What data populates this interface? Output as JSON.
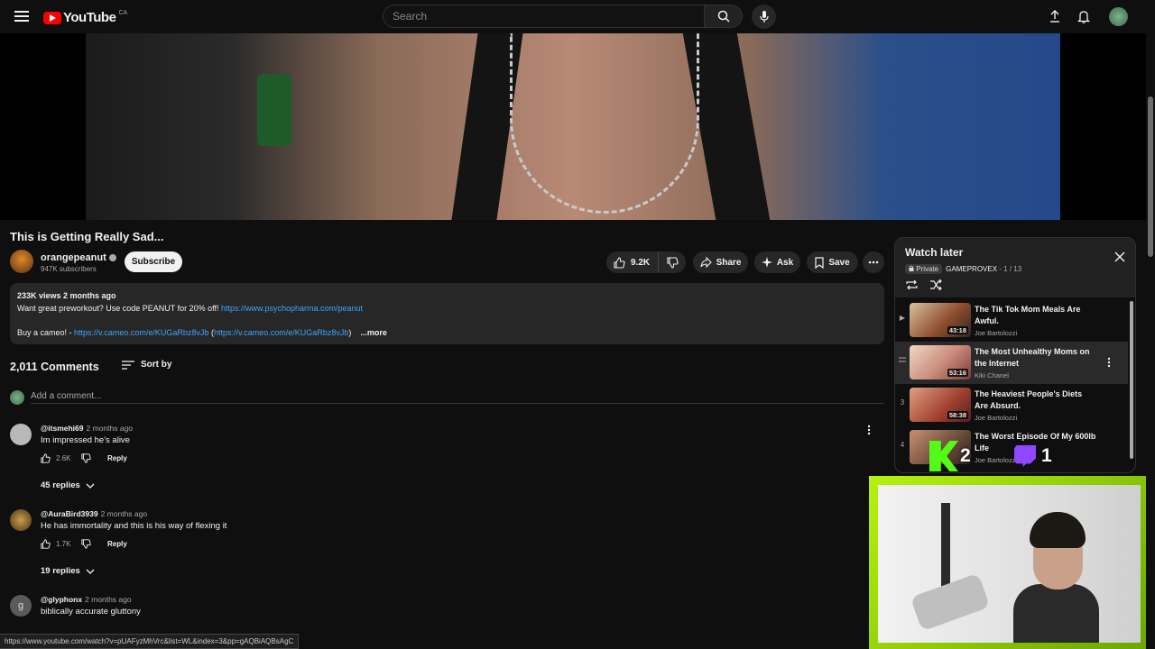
{
  "header": {
    "logo_text": "YouTube",
    "region": "CA",
    "search_placeholder": "Search"
  },
  "video": {
    "title": "This is Getting Really Sad...",
    "channel": "orangepeanut",
    "subscribers": "947K subscribers",
    "subscribe_label": "Subscribe",
    "likes": "9.2K",
    "share_label": "Share",
    "ask_label": "Ask",
    "save_label": "Save"
  },
  "description": {
    "stats": "233K views  2 months ago",
    "line1_text": "Want great preworkout? Use code PEANUT for 20% off! ",
    "line1_link": "https://www.psychopharma.com/peanut",
    "line2_text": "Buy a cameo! - ",
    "line2_link": "https://v.cameo.com/e/KUGaRbz8vJb",
    "line2_paren_open": " (",
    "line2_link2": "https://v.cameo.com/e/KUGaRbz8vJb",
    "line2_paren_close": ")",
    "more_label": "...more"
  },
  "comments": {
    "count_label": "2,011 Comments",
    "sort_label": "Sort by",
    "add_placeholder": "Add a comment...",
    "items": [
      {
        "author": "@itsmehi69",
        "time": "2 months ago",
        "text": "Im impressed he's alive",
        "likes": "2.6K",
        "reply_label": "Reply",
        "replies": "45 replies",
        "avatar_color": "#b9b9b9"
      },
      {
        "author": "@AuraBird3939",
        "time": "2 months ago",
        "text": "He has immortality and this is his way of flexing it",
        "likes": "1.7K",
        "reply_label": "Reply",
        "replies": "19 replies",
        "avatar_color": "#7a5a2a"
      },
      {
        "author": "@glyphonx",
        "time": "2 months ago",
        "text": "biblically accurate gluttony",
        "likes": "",
        "reply_label": "",
        "replies": "",
        "avatar_color": "#5a5a5a",
        "avatar_letter": "g"
      }
    ]
  },
  "watch_later": {
    "title": "Watch later",
    "privacy": "Private",
    "owner": "GAMEPROVEX",
    "position": "1 / 13",
    "items": [
      {
        "index": "▶",
        "title": "The Tik Tok Mom Meals Are Awful.",
        "channel": "Joe Bartolozzi",
        "duration": "43:18",
        "thumb": "#8a4a2a"
      },
      {
        "index": "",
        "title": "The Most Unhealthy Moms on the Internet",
        "channel": "Kiki Chanel",
        "duration": "53:16",
        "thumb": "#c98a7a"
      },
      {
        "index": "3",
        "title": "The Heaviest People's Diets Are Absurd.",
        "channel": "Joe Bartolozzi",
        "duration": "58:38",
        "thumb": "#a04030"
      },
      {
        "index": "4",
        "title": "The Worst Episode Of My 600lb Life",
        "channel": "Joe Bartolozzi",
        "duration": "",
        "thumb": "#6a4a3a"
      }
    ]
  },
  "overlay": {
    "kick_count": "2",
    "twitch_count": "1"
  },
  "statusbar": {
    "url": "https://www.youtube.com/watch?v=pUAFyzMhVrc&list=WL&index=3&pp=gAQBiAQBsAgC"
  }
}
